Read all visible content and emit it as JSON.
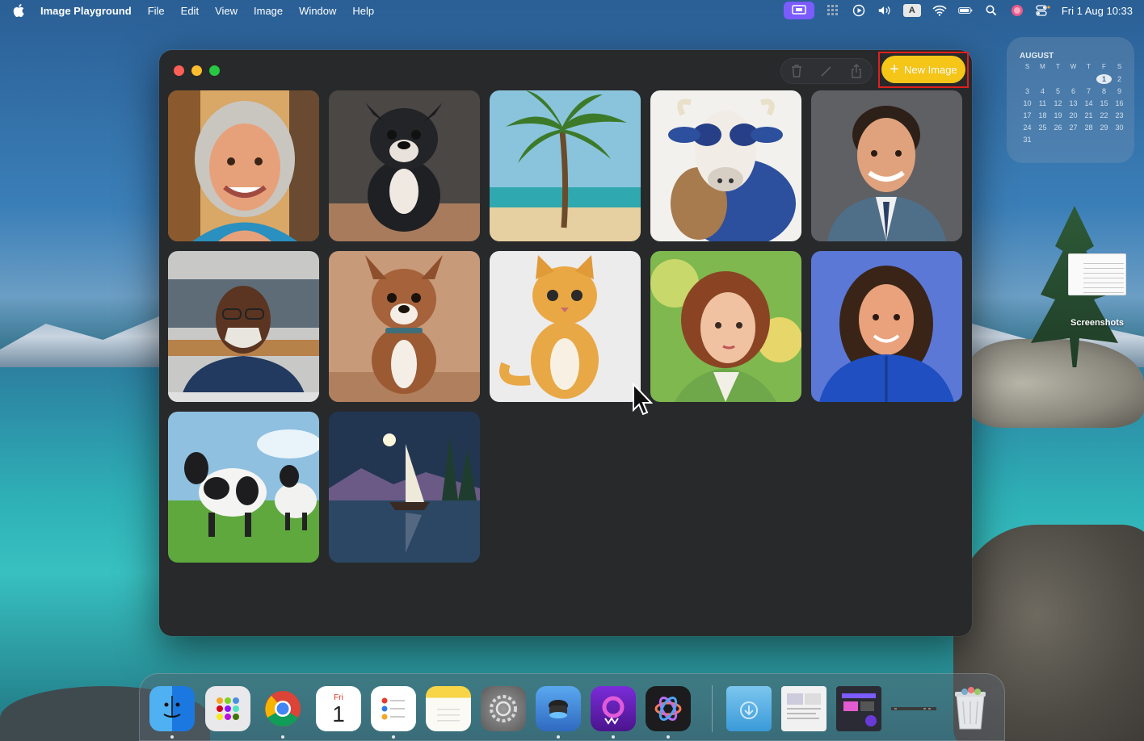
{
  "menubar": {
    "app_name": "Image Playground",
    "menus": [
      "File",
      "Edit",
      "View",
      "Image",
      "Window",
      "Help"
    ],
    "input_source": "A",
    "clock": "Fri 1 Aug 10:33"
  },
  "calendar_widget": {
    "month": "AUGUST",
    "weekdays": [
      "S",
      "M",
      "T",
      "W",
      "T",
      "F",
      "S"
    ],
    "days": [
      "",
      "",
      "",
      "",
      "",
      "1",
      "2",
      "3",
      "4",
      "5",
      "6",
      "7",
      "8",
      "9",
      "10",
      "11",
      "12",
      "13",
      "14",
      "15",
      "16",
      "17",
      "18",
      "19",
      "20",
      "21",
      "22",
      "23",
      "24",
      "25",
      "26",
      "27",
      "28",
      "29",
      "30",
      "31"
    ],
    "today": "1"
  },
  "desktop": {
    "file_label": "Screenshots"
  },
  "window": {
    "toolbar": {
      "delete_icon": "trash-icon",
      "edit_icon": "pencil-icon",
      "share_icon": "share-icon"
    },
    "new_image_button": {
      "icon": "plus-icon",
      "label": "New Image"
    },
    "gallery": [
      "older-woman-portrait",
      "black-dog",
      "palm-tree-beach",
      "blue-cow",
      "young-man-suit",
      "older-man-glasses",
      "brown-dog",
      "orange-tabby-cat",
      "woman-auburn-hair",
      "woman-blue-jacket",
      "cows-in-field",
      "sailboat-moonlit-lake"
    ]
  },
  "dock": {
    "calendar_day_abbr": "Fri",
    "calendar_day_num": "1",
    "apps": [
      "finder",
      "launchpad",
      "chrome",
      "calendar",
      "reminders",
      "notes",
      "system-settings",
      "app-store-like",
      "wondershare",
      "image-playground",
      "downloads",
      "screenshots-stack",
      "screen-recorder",
      "minimized-window",
      "trash"
    ]
  }
}
